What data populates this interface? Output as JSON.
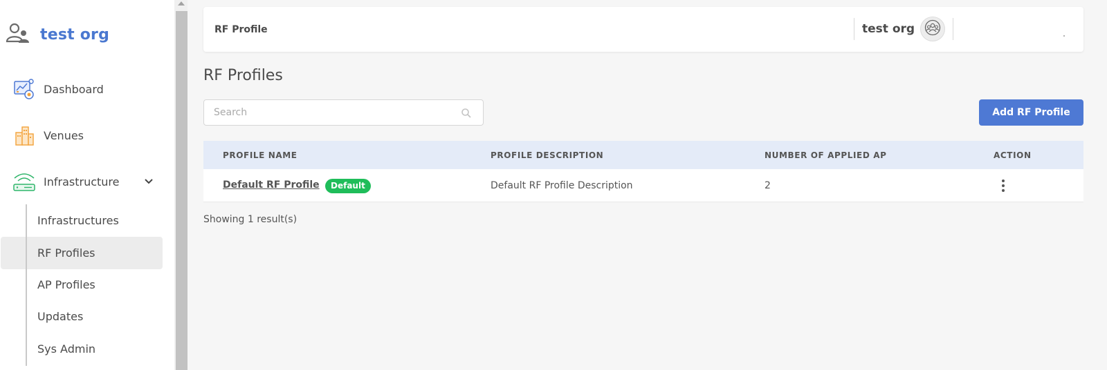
{
  "sidebar": {
    "org_name": "test org",
    "nav": [
      {
        "label": "Dashboard",
        "icon": "dashboard-icon"
      },
      {
        "label": "Venues",
        "icon": "venues-icon"
      },
      {
        "label": "Infrastructure",
        "icon": "infrastructure-icon"
      }
    ],
    "sub_items": [
      {
        "label": "Infrastructures"
      },
      {
        "label": "RF Profiles",
        "active": true
      },
      {
        "label": "AP Profiles"
      },
      {
        "label": "Updates"
      },
      {
        "label": "Sys Admin"
      }
    ]
  },
  "header": {
    "title": "RF Profile",
    "org_name": "test org"
  },
  "main": {
    "page_title": "RF Profiles",
    "search_placeholder": "Search",
    "add_button_label": "Add RF Profile",
    "columns": [
      "PROFILE NAME",
      "PROFILE DESCRIPTION",
      "NUMBER OF APPLIED AP",
      "ACTION"
    ],
    "rows": [
      {
        "name": "Default RF Profile",
        "badge": "Default",
        "description": "Default RF Profile Description",
        "applied_ap": "2"
      }
    ],
    "results_text": "Showing 1 result(s)"
  },
  "colors": {
    "accent": "#4e79d4",
    "org_text": "#4a78d0",
    "badge_green": "#1fbd5a",
    "table_header_bg": "#e4ebf8"
  }
}
